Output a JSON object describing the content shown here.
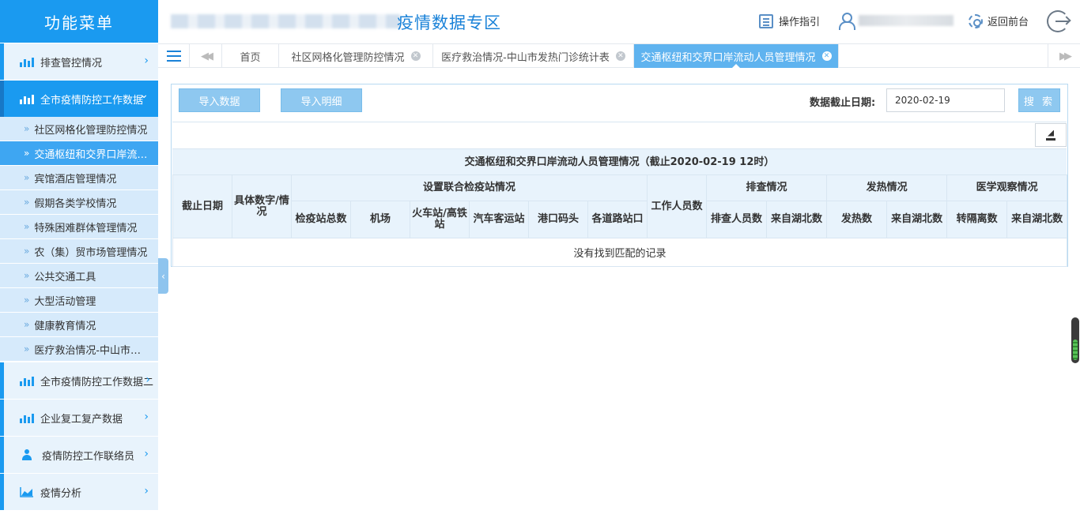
{
  "sidebar": {
    "brand": "功能菜单",
    "groups": [
      {
        "label": "排查管控情况",
        "icon": "bar-chart-icon",
        "expanded": false
      },
      {
        "label": "全市疫情防控工作数据",
        "icon": "bar-chart-icon",
        "expanded": true
      },
      {
        "label": "全市疫情防控工作数据二",
        "icon": "bar-chart-icon",
        "expanded": false
      },
      {
        "label": "企业复工复产数据",
        "icon": "bar-chart-icon",
        "expanded": false
      },
      {
        "label": "疫情防控工作联络员",
        "icon": "person-icon",
        "expanded": false
      },
      {
        "label": "疫情分析",
        "icon": "area-chart-icon",
        "expanded": false
      }
    ],
    "sub_items": [
      "社区网格化管理防控情况",
      "交通枢纽和交界口岸流…",
      "宾馆酒店管理情况",
      "假期各类学校情况",
      "特殊困难群体管理情况",
      "农（集）贸市场管理情况",
      "公共交通工具",
      "大型活动管理",
      "健康教育情况",
      "医疗救治情况-中山市…"
    ],
    "active_sub_index": 1,
    "collapse_glyph": "‹"
  },
  "header": {
    "title": "疫情数据专区",
    "guide": "操作指引",
    "back": "返回前台"
  },
  "tabs": {
    "items": [
      {
        "label": "首页",
        "closable": false
      },
      {
        "label": "社区网格化管理防控情况",
        "closable": true
      },
      {
        "label": "医疗救治情况-中山市发热门诊统计表",
        "closable": true
      },
      {
        "label": "交通枢纽和交界口岸流动人员管理情况",
        "closable": true,
        "active": true
      }
    ],
    "close_glyph": "✕",
    "prev_glyph": "◀◀",
    "next_glyph": "▶▶"
  },
  "toolbar": {
    "import_data": "导入数据",
    "import_detail": "导入明细",
    "date_label": "数据截止日期:",
    "date_value": "2020-02-19",
    "search": "搜 索"
  },
  "table": {
    "title": "交通枢纽和交界口岸流动人员管理情况（截止2020-02-19 12时）",
    "headers": {
      "cutoff_date": "截止日期",
      "specific_number": "具体数字/情况",
      "checkpoint_group": "设置联合检疫站情况",
      "checkpoint_cols": [
        "检疫站总数",
        "机场",
        "火车站/高铁站",
        "汽车客运站",
        "港口码头",
        "各道路站口"
      ],
      "staff_count": "工作人员数",
      "screening_group": "排查情况",
      "screening_cols": [
        "排查人员数",
        "来自湖北数"
      ],
      "fever_group": "发热情况",
      "fever_cols": [
        "发热数",
        "来自湖北数"
      ],
      "observation_group": "医学观察情况",
      "observation_cols": [
        "转隔离数",
        "来自湖北数"
      ]
    },
    "empty_message": "没有找到匹配的记录"
  },
  "colors": {
    "primary": "#1a9af0",
    "active_tab": "#5fb3ef",
    "button": "#8ec8f0",
    "header_title": "#1a82d8",
    "table_header_bg": "#e8f3fc"
  }
}
